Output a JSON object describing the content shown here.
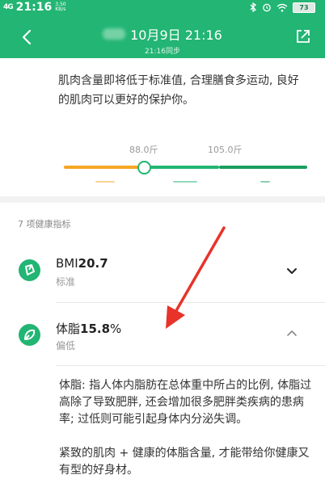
{
  "status_bar": {
    "signal": "4G",
    "time": "21:16",
    "net_speed_value": "3.50",
    "net_speed_unit": "KB/s",
    "battery": "73"
  },
  "header": {
    "date_title": "10月9日 21:16",
    "sync_subtitle": "21:16同步"
  },
  "muscle_info": {
    "text": "肌肉含量即将低于标准值, 合理膳食多运动, 良好的肌肉可以更好的保护你。"
  },
  "scale": {
    "low_threshold_label": "88.0斤",
    "high_threshold_label": "105.0斤",
    "marker_value": 88.0,
    "range_min": 70.0,
    "range_max": 125.0,
    "colors": {
      "low": "#f5a623",
      "normal": "#22b573",
      "high": "#1a9e5f"
    }
  },
  "section": {
    "title": "7 项健康指标"
  },
  "metrics": [
    {
      "name_prefix": "BMI",
      "value": "20.7",
      "unit": "",
      "status": "标准",
      "expanded": false
    },
    {
      "name_prefix": "体脂",
      "value": "15.8",
      "unit": "%",
      "status": "偏低",
      "expanded": true
    }
  ],
  "body_fat_detail": {
    "paragraph1": "体脂: 指人体内脂肪在总体重中所占的比例, 体脂过高除了导致肥胖, 还会增加很多肥胖类疾病的患病率; 过低则可能引起身体内分泌失调。",
    "paragraph2": "紧致的肌肉 + 健康的体脂含量, 才能带给你健康又有型的好身材。"
  },
  "colors": {
    "brand": "#22b573",
    "annotation_arrow": "#e8332a"
  }
}
